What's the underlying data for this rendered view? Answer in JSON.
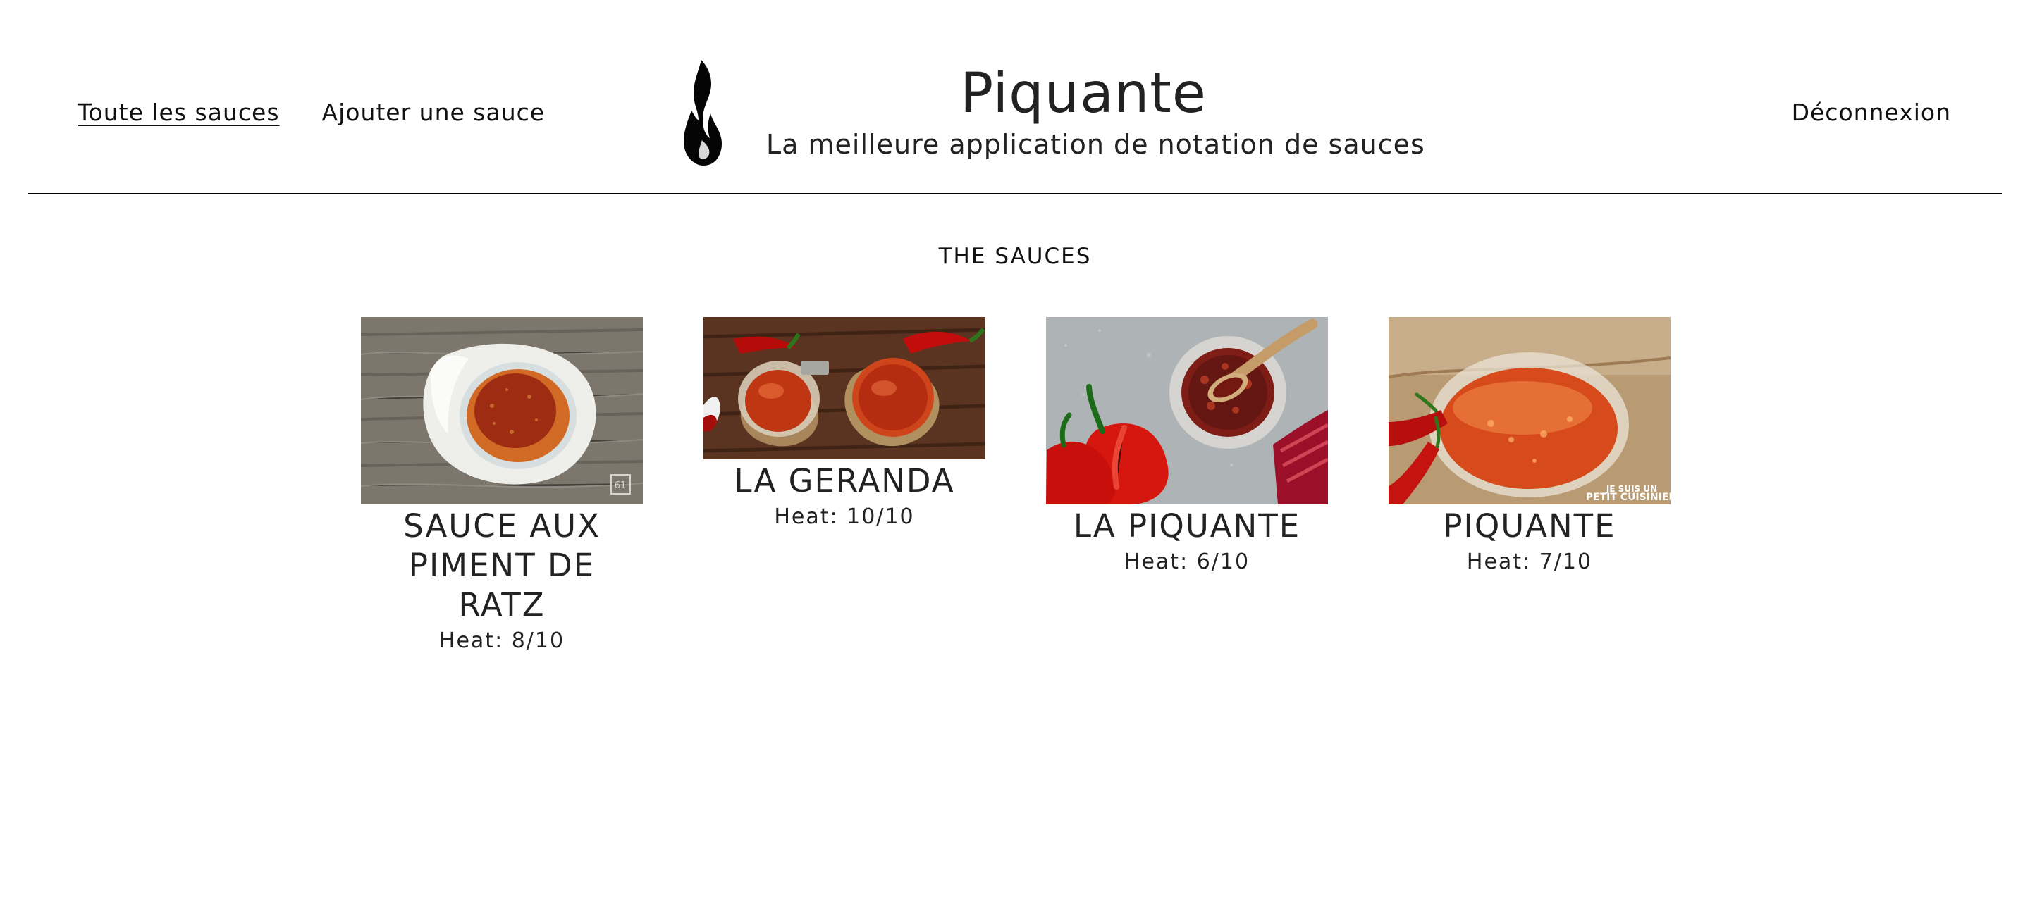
{
  "header": {
    "nav_left": [
      {
        "label": "Toute les sauces"
      },
      {
        "label": "Ajouter une sauce"
      }
    ],
    "brand_title": "Piquante",
    "brand_subtitle": "La meilleure application de notation de sauces",
    "nav_right": "Déconnexion",
    "logo_icon": "flame-icon"
  },
  "main": {
    "section_title": "THE SAUCES",
    "sauces": [
      {
        "name": "SAUCE AUX PIMENT DE RATZ",
        "heat_label": "Heat: 8/10",
        "heat_value": 8,
        "heat_max": 10,
        "image_icon": "sauce-in-white-dish-image"
      },
      {
        "name": "LA GERANDA",
        "heat_label": "Heat: 10/10",
        "heat_value": 10,
        "heat_max": 10,
        "image_icon": "sauce-jars-with-chilis-image"
      },
      {
        "name": "LA PIQUANTE",
        "heat_label": "Heat: 6/10",
        "heat_value": 6,
        "heat_max": 10,
        "image_icon": "jar-with-spoon-and-peppers-image"
      },
      {
        "name": "PIQUANTE",
        "heat_label": "Heat: 7/10",
        "heat_value": 7,
        "heat_max": 10,
        "image_icon": "sauce-in-glass-bowl-image"
      }
    ]
  },
  "colors": {
    "text": "#1f2124",
    "divider": "#000000",
    "background": "#ffffff"
  }
}
